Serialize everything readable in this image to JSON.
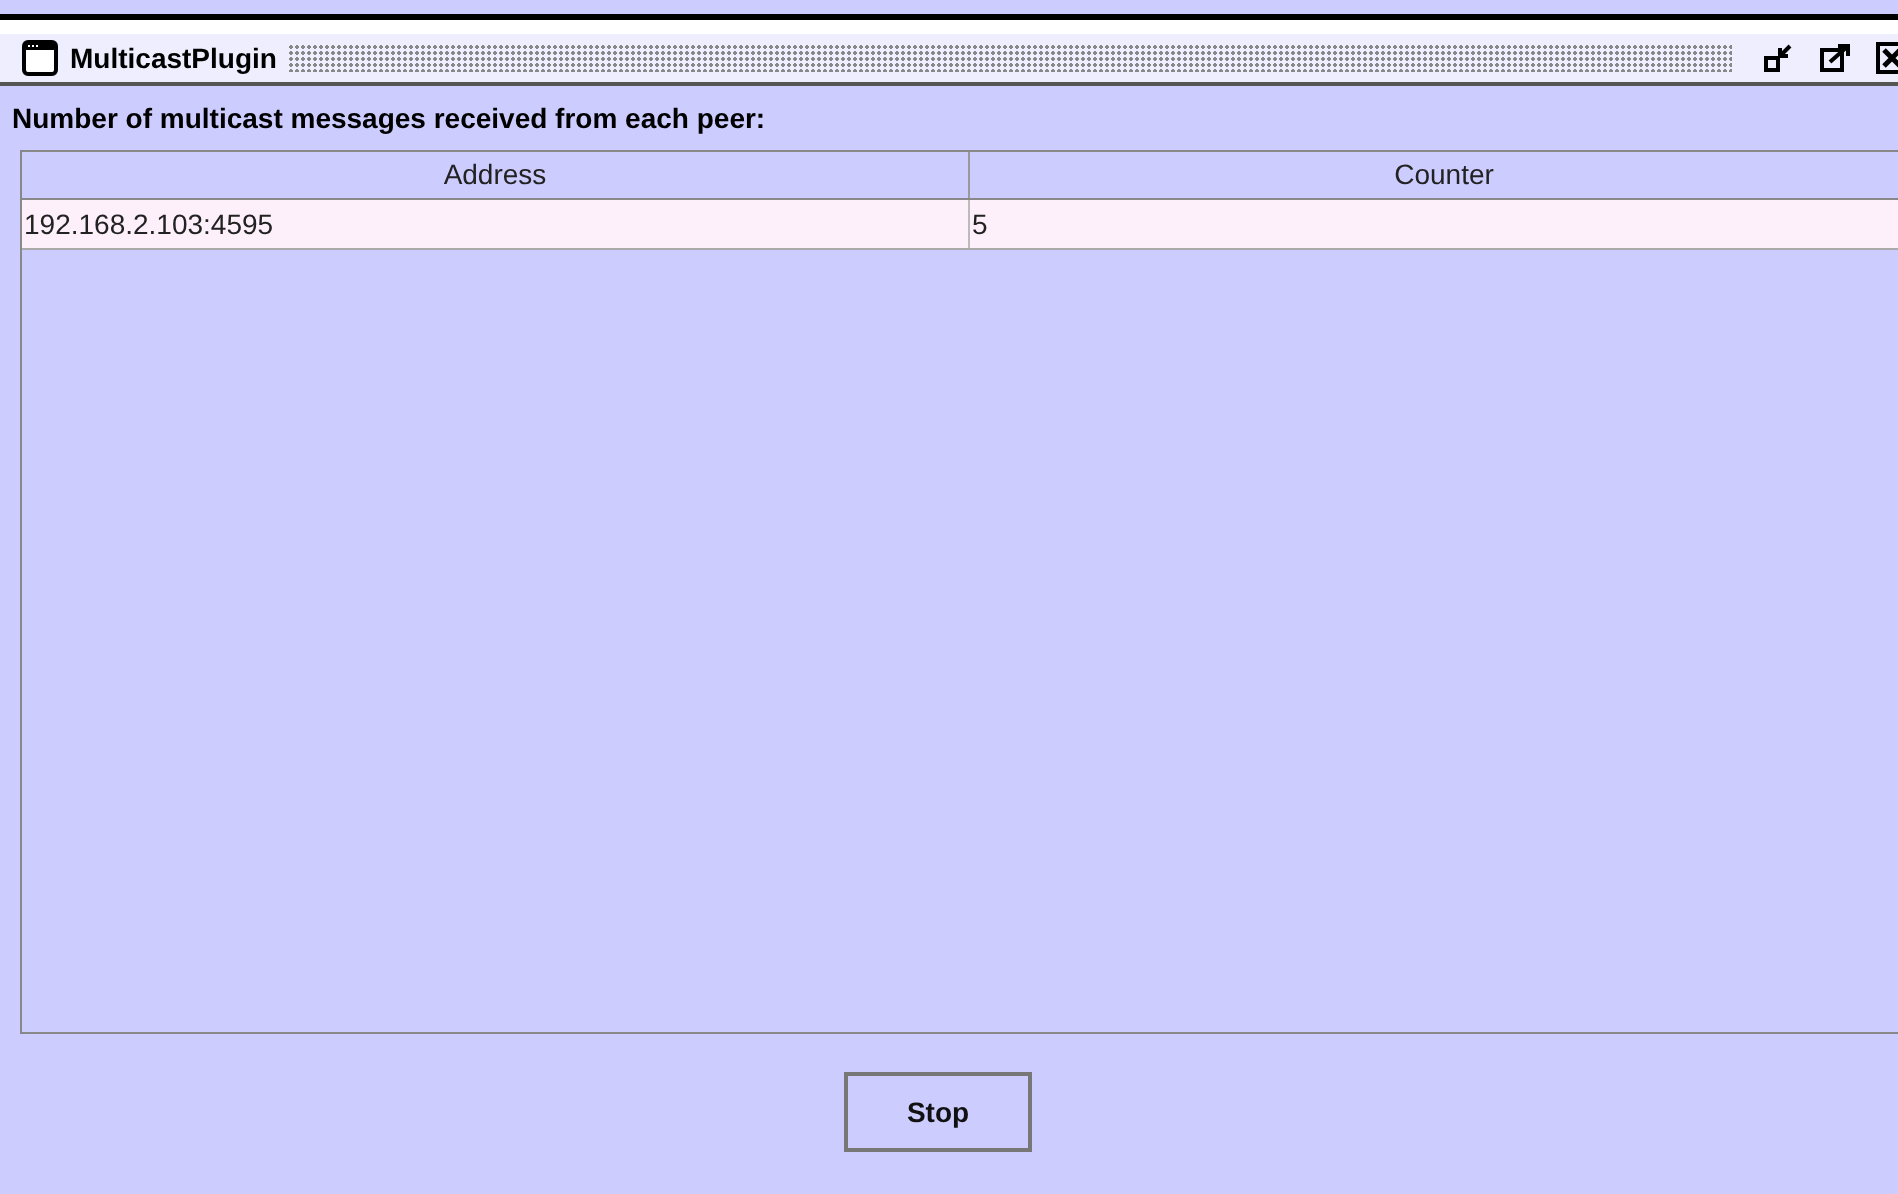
{
  "window": {
    "title": "MulticastPlugin"
  },
  "heading": "Number of multicast messages received from each peer:",
  "table": {
    "columns": [
      "Address",
      "Counter"
    ],
    "rows": [
      [
        "192.168.2.103:4595",
        "5"
      ]
    ]
  },
  "buttons": [
    "Stop"
  ]
}
